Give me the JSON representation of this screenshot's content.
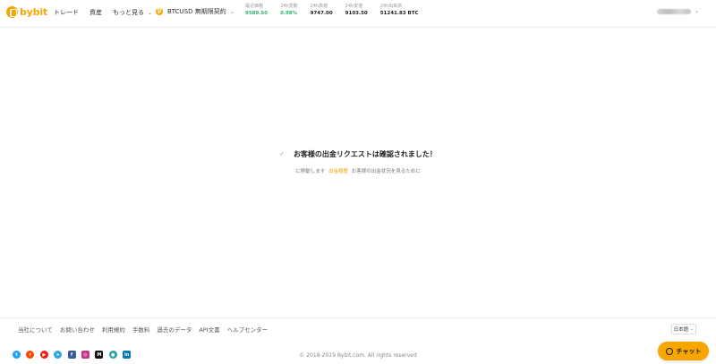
{
  "header": {
    "logo_text": "bybit",
    "nav": [
      "トレード",
      "資産",
      "もっと見る"
    ],
    "pair": {
      "coin": "₿",
      "name": "BTCUSD 無期限契約"
    },
    "stats": [
      {
        "label": "最近価格",
        "value": "9589.50",
        "color": "green"
      },
      {
        "label": "24h変動",
        "value": "0.98%",
        "color": "green"
      },
      {
        "label": "24h高値",
        "value": "9747.00",
        "color": "default"
      },
      {
        "label": "24h安値",
        "value": "9103.50",
        "color": "default"
      },
      {
        "label": "24h出来高",
        "value": "51241.83 BTC",
        "color": "default"
      }
    ]
  },
  "main": {
    "check_icon": "✓",
    "title": "お客様の出金リクエストは確認されました！",
    "sub_before": "に移動します",
    "sub_link": "出金履歴",
    "sub_after": "お客様の出金状況を見るために"
  },
  "footer": {
    "links": [
      "当社について",
      "お問い合わせ",
      "利用規約",
      "手数料",
      "過去のデータ",
      "API文書",
      "ヘルプセンター"
    ],
    "language": "日本語",
    "copyright": "© 2018-2019 Bybit.com. All rights reserved",
    "socials": [
      {
        "name": "twitter-icon",
        "color": "#1da1f2",
        "glyph": "t"
      },
      {
        "name": "reddit-icon",
        "color": "#ff4500",
        "glyph": "r"
      },
      {
        "name": "youtube-icon",
        "color": "#e62117",
        "glyph": "▶"
      },
      {
        "name": "telegram-icon",
        "color": "#2ca5e0",
        "glyph": "➤"
      },
      {
        "name": "facebook-icon",
        "color": "#3b5998",
        "glyph": "f"
      },
      {
        "name": "instagram-icon",
        "color": "#c13584",
        "glyph": "◎"
      },
      {
        "name": "medium-icon",
        "color": "#111111",
        "glyph": "M"
      },
      {
        "name": "discord-icon",
        "color": "#26a69a",
        "glyph": "●"
      },
      {
        "name": "linkedin-icon",
        "color": "#0077b5",
        "glyph": "in"
      }
    ]
  },
  "chat": {
    "label": "チャット"
  },
  "colors": {
    "brand": "#f7a600",
    "up": "#33b36b"
  }
}
